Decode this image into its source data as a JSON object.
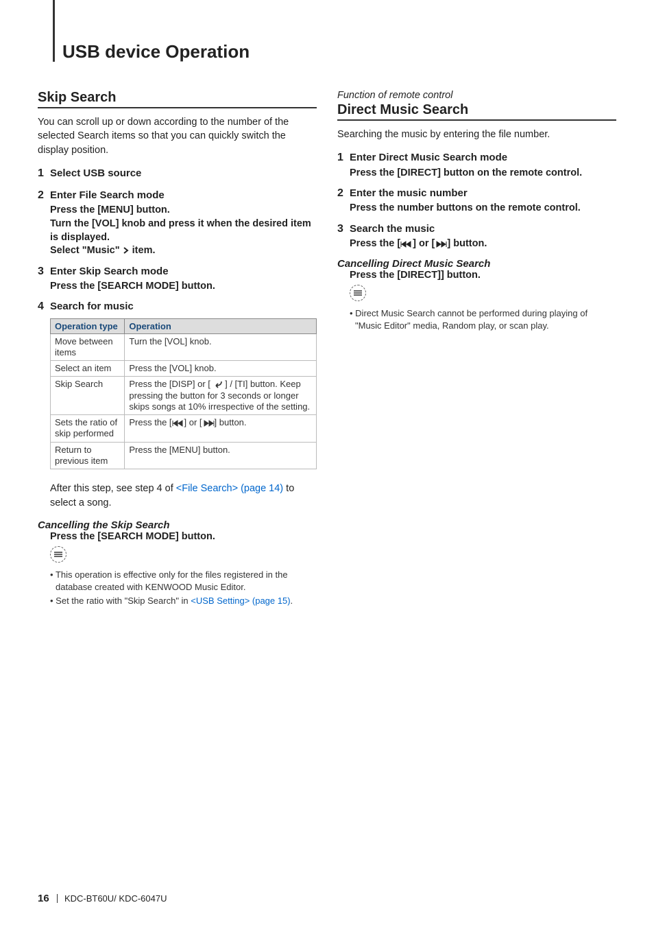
{
  "page_title": "USB device Operation",
  "left": {
    "heading": "Skip Search",
    "intro": "You can scroll up or down according to the number of the selected Search items so that you can quickly switch the display position.",
    "steps": [
      {
        "num": "1",
        "title": "Select USB source"
      },
      {
        "num": "2",
        "title": "Enter File Search mode",
        "lines": [
          "Press the [MENU] button.",
          "Turn the [VOL] knob and press it when the desired item is displayed.",
          "Select \"Music\" > item."
        ],
        "select_prefix": "Select \"Music\" ",
        "select_suffix": " item."
      },
      {
        "num": "3",
        "title": "Enter Skip Search mode",
        "lines": [
          "Press the [SEARCH MODE] button."
        ]
      },
      {
        "num": "4",
        "title": "Search for music"
      }
    ],
    "table": {
      "headers": [
        "Operation type",
        "Operation"
      ],
      "rows": [
        [
          "Move between items",
          "Turn the [VOL] knob."
        ],
        [
          "Select an item",
          "Press the [VOL] knob."
        ],
        [
          "Skip Search",
          "Press the [DISP] or [ ↶ ] / [TI] button. Keep pressing the button for 3 seconds or longer skips songs at 10% irrespective of the setting."
        ],
        [
          "Sets the ratio of skip performed",
          "Press the [|◀◀] or [▶▶|] button."
        ],
        [
          "Return to previous item",
          "Press the [MENU] button."
        ]
      ],
      "r2_prefix": "Press the [DISP] or [ ",
      "r2_suffix": " ] / [TI] button. Keep pressing the button for 3 seconds or longer skips songs at 10% irrespective of the setting.",
      "r3_prefix": "Press the [",
      "r3_mid": "] or [",
      "r3_suffix": "] button."
    },
    "after_step_prefix": "After this step, see step 4 of ",
    "after_step_link": "<File Search> (page 14)",
    "after_step_suffix": " to select a song.",
    "cancel_heading": "Cancelling the Skip Search",
    "cancel_instr": "Press the [SEARCH MODE] button.",
    "notes": [
      "This operation is effective only for the files registered in the database created with KENWOOD Music Editor."
    ],
    "note2_prefix": "Set the ratio with \"Skip Search\" in ",
    "note2_link": "<USB Setting> (page 15)",
    "note2_suffix": "."
  },
  "right": {
    "fn": "Function of remote control",
    "heading": "Direct Music Search",
    "intro": "Searching the music by entering the file number.",
    "steps": [
      {
        "num": "1",
        "title": "Enter Direct Music Search mode",
        "lines": [
          "Press the [DIRECT] button on the remote control."
        ]
      },
      {
        "num": "2",
        "title": "Enter the music number",
        "lines": [
          "Press the number buttons on the remote control."
        ]
      },
      {
        "num": "3",
        "title": "Search the music",
        "press_prefix": "Press the [",
        "press_mid": "] or [",
        "press_suffix": "] button."
      }
    ],
    "cancel_heading": "Cancelling Direct Music Search",
    "cancel_instr": "Press the [DIRECT]] button.",
    "notes": [
      "Direct Music Search cannot be performed during playing of \"Music Editor\" media, Random play, or scan play."
    ]
  },
  "footer": {
    "page": "16",
    "model": "KDC-BT60U/ KDC-6047U"
  }
}
